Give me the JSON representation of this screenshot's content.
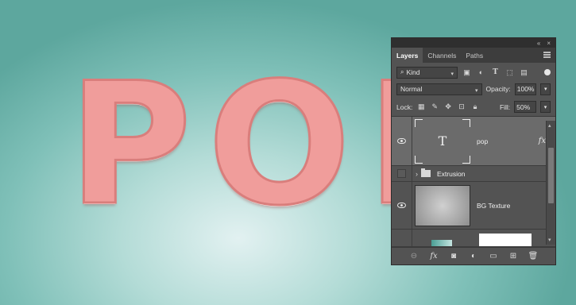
{
  "canvas": {
    "text": "POP"
  },
  "panel": {
    "collapse_glyph": "«",
    "close_glyph": "×",
    "tabs": [
      {
        "label": "Layers",
        "active": true
      },
      {
        "label": "Channels",
        "active": false
      },
      {
        "label": "Paths",
        "active": false
      }
    ],
    "filter": {
      "label": "Kind",
      "icons": [
        "image-filter-icon",
        "adjustment-filter-icon",
        "type-filter-icon",
        "shape-filter-icon",
        "smart-object-filter-icon"
      ]
    },
    "blend_mode": "Normal",
    "opacity_label": "Opacity:",
    "opacity_value": "100%",
    "lock_label": "Lock:",
    "fill_label": "Fill:",
    "fill_value": "50%",
    "layers": [
      {
        "name": "pop",
        "type": "text",
        "visible": true,
        "selected": true,
        "thumb_glyph": "T",
        "fx": "fx"
      },
      {
        "name": "Extrusion",
        "type": "group",
        "visible": false,
        "selected": false
      },
      {
        "name": "BG Texture",
        "type": "image",
        "visible": true,
        "selected": false
      }
    ],
    "bottom_fx": "fx"
  }
}
